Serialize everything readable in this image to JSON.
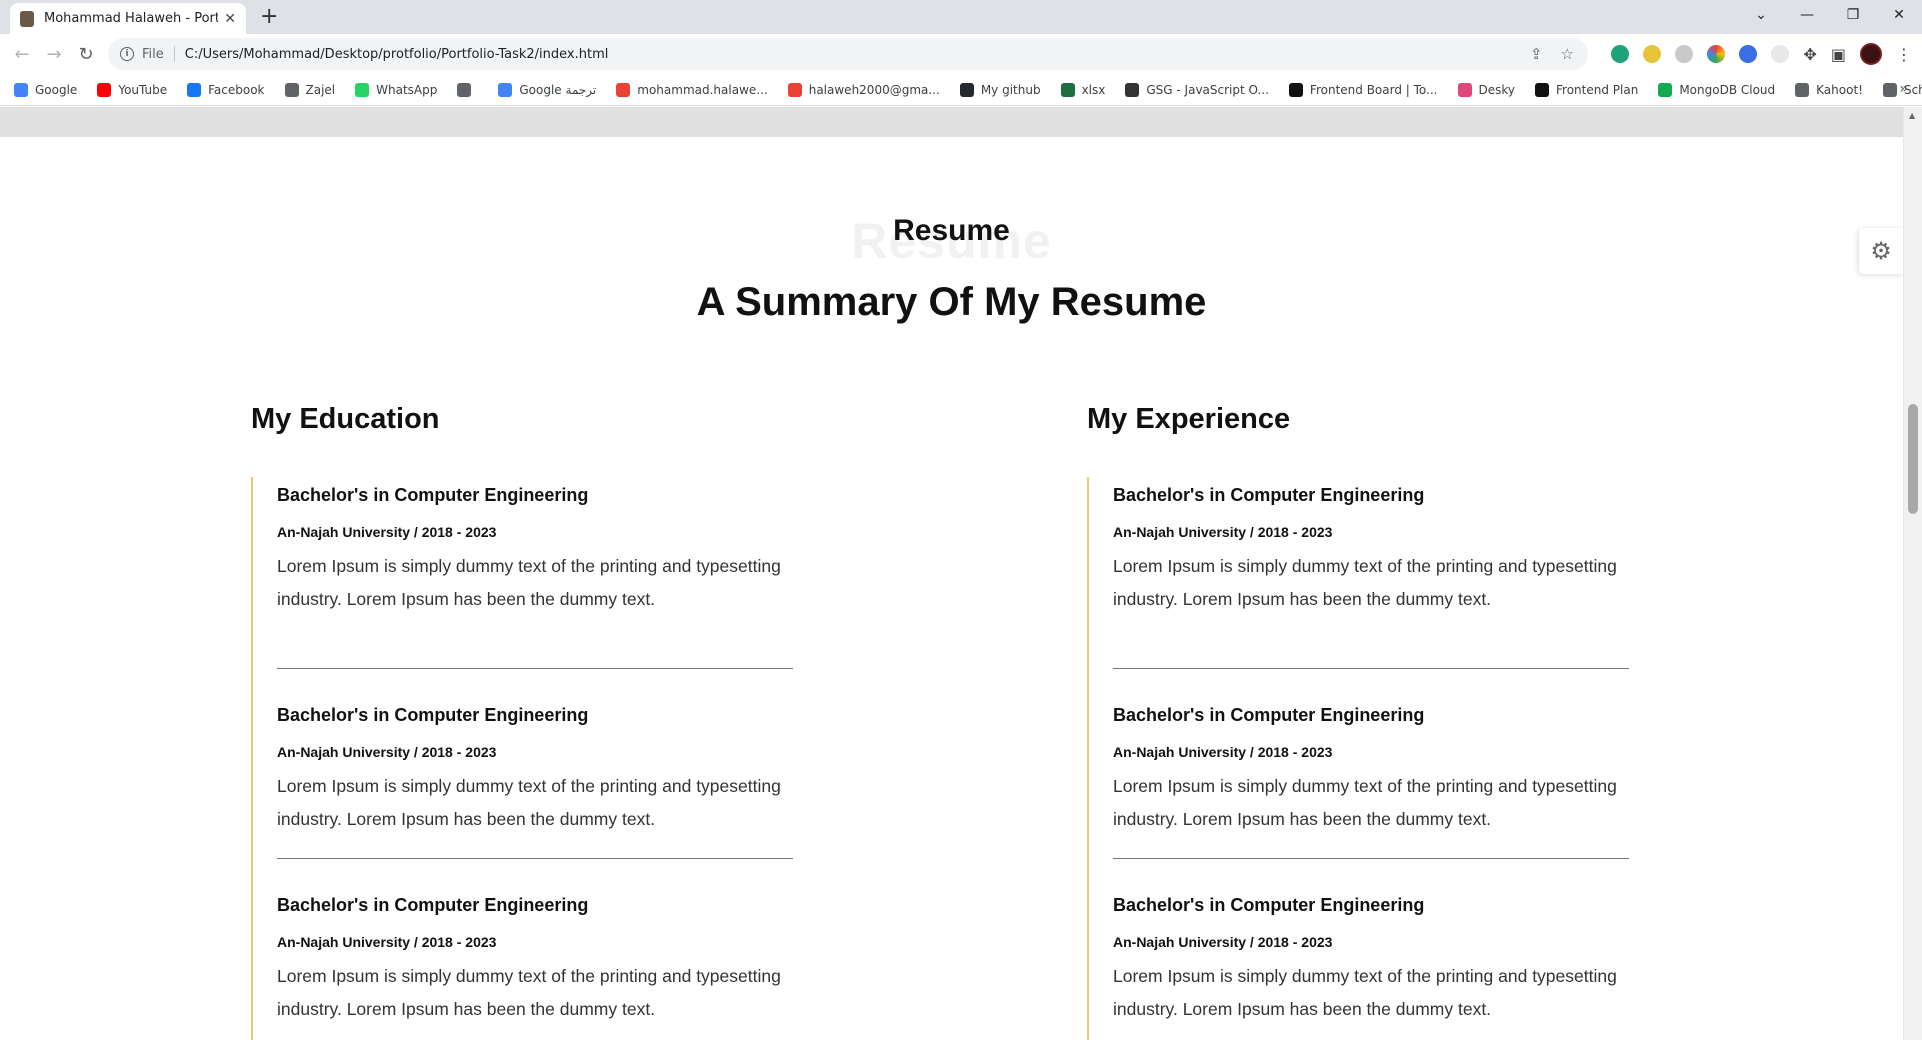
{
  "browser": {
    "tab_title": "Mohammad Halaweh - Portfolio",
    "tab_close": "✕",
    "new_tab": "+",
    "url_scheme": "File",
    "url": "C:/Users/Mohammad/Desktop/protfolio/Portfolio-Task2/index.html",
    "window_controls": [
      "⌄",
      "—",
      "❐",
      "✕"
    ]
  },
  "bookmarks": [
    {
      "label": "Google",
      "color": "#4285f4"
    },
    {
      "label": "YouTube",
      "color": "#ff0000"
    },
    {
      "label": "Facebook",
      "color": "#1877f2"
    },
    {
      "label": "Zajel",
      "color": "#5f6368"
    },
    {
      "label": "WhatsApp",
      "color": "#25d366"
    },
    {
      "label": "",
      "color": "#5f6368"
    },
    {
      "label": "Google ترجمة",
      "color": "#4285f4"
    },
    {
      "label": "mohammad.halawe...",
      "color": "#ea4335"
    },
    {
      "label": "halaweh2000@gma...",
      "color": "#ea4335"
    },
    {
      "label": "My github",
      "color": "#24292e"
    },
    {
      "label": "xlsx",
      "color": "#1d6f42"
    },
    {
      "label": "GSG - JavaScript O...",
      "color": "#333333"
    },
    {
      "label": "Frontend Board | To...",
      "color": "#111111"
    },
    {
      "label": "Desky",
      "color": "#e0457b"
    },
    {
      "label": "Frontend Plan",
      "color": "#111111"
    },
    {
      "label": "MongoDB Cloud",
      "color": "#13aa52"
    },
    {
      "label": "Kahoot!",
      "color": "#5f6368"
    },
    {
      "label": "Schneider NextGen...",
      "color": "#5f6368"
    }
  ],
  "bookmarks_more": "»",
  "resume": {
    "bg_word": "Resume",
    "tag": "Resume",
    "title": "A Summary Of My Resume",
    "education_title": "My Education",
    "experience_title": "My Experience",
    "education": [
      {
        "title": "Bachelor's in Computer Engineering",
        "subtitle": "An-Najah University / 2018 - 2023",
        "desc": "Lorem Ipsum is simply dummy text of the printing and typesetting industry. Lorem Ipsum has been the dummy text."
      },
      {
        "title": "Bachelor's in Computer Engineering",
        "subtitle": "An-Najah University / 2018 - 2023",
        "desc": "Lorem Ipsum is simply dummy text of the printing and typesetting industry. Lorem Ipsum has been the dummy text."
      },
      {
        "title": "Bachelor's in Computer Engineering",
        "subtitle": "An-Najah University / 2018 - 2023",
        "desc": "Lorem Ipsum is simply dummy text of the printing and typesetting industry. Lorem Ipsum has been the dummy text."
      }
    ],
    "experience": [
      {
        "title": "Bachelor's in Computer Engineering",
        "subtitle": "An-Najah University / 2018 - 2023",
        "desc": "Lorem Ipsum is simply dummy text of the printing and typesetting industry. Lorem Ipsum has been the dummy text."
      },
      {
        "title": "Bachelor's in Computer Engineering",
        "subtitle": "An-Najah University / 2018 - 2023",
        "desc": "Lorem Ipsum is simply dummy text of the printing and typesetting industry. Lorem Ipsum has been the dummy text."
      },
      {
        "title": "Bachelor's in Computer Engineering",
        "subtitle": "An-Najah University / 2018 - 2023",
        "desc": "Lorem Ipsum is simply dummy text of the printing and typesetting industry. Lorem Ipsum has been the dummy text."
      }
    ]
  },
  "colors": {
    "accent_line": "#e6c879",
    "strip": "#e0e0e0"
  }
}
